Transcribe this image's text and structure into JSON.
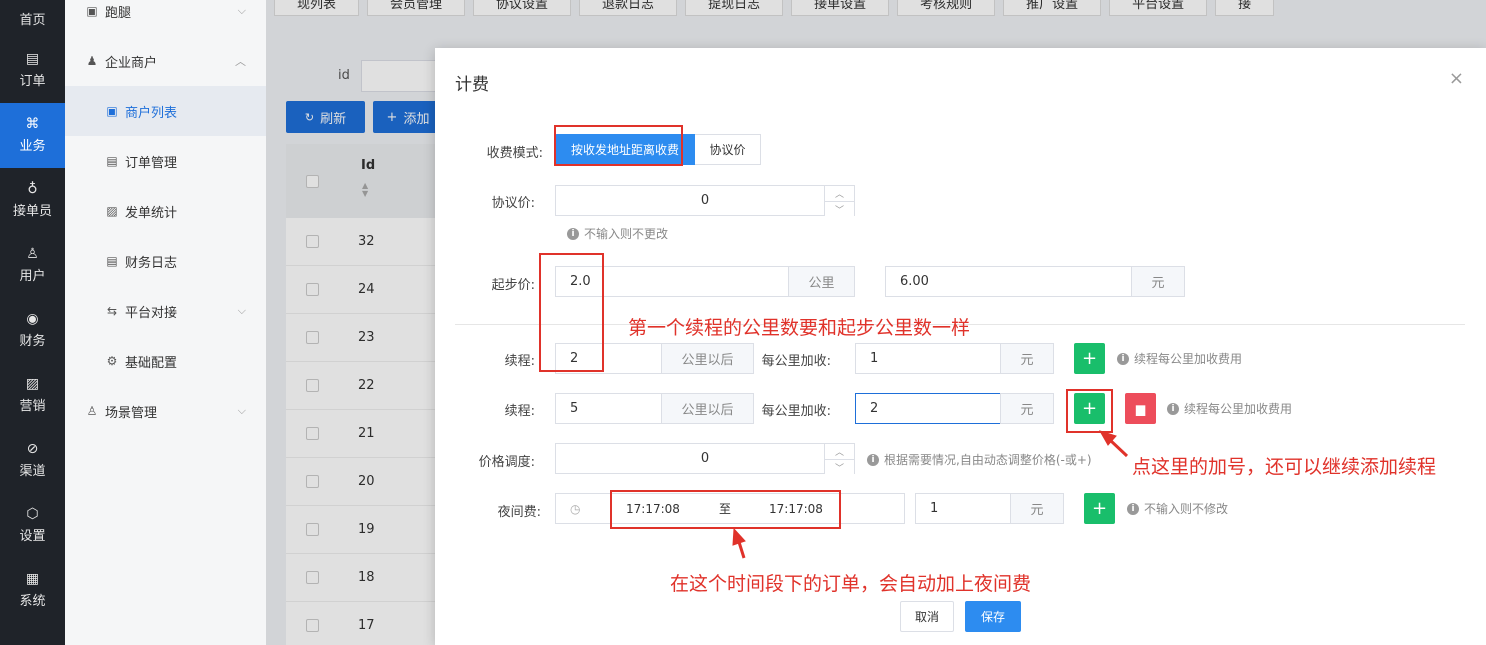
{
  "leftnav": [
    {
      "icon": "home-icon",
      "glyph": "⌂",
      "label": "首页"
    },
    {
      "icon": "order-icon",
      "glyph": "▤",
      "label": "订单"
    },
    {
      "icon": "business-icon",
      "glyph": "⌘",
      "label": "业务"
    },
    {
      "icon": "bike-icon",
      "glyph": "♁",
      "label": "接单员"
    },
    {
      "icon": "user-icon",
      "glyph": "♙",
      "label": "用户"
    },
    {
      "icon": "finance-icon",
      "glyph": "◉",
      "label": "财务"
    },
    {
      "icon": "marketing-icon",
      "glyph": "▨",
      "label": "营销"
    },
    {
      "icon": "channel-icon",
      "glyph": "⊘",
      "label": "渠道"
    },
    {
      "icon": "settings-icon",
      "glyph": "⬡",
      "label": "设置"
    },
    {
      "icon": "system-icon",
      "glyph": "▦",
      "label": "系统"
    }
  ],
  "subnav": {
    "paotui": "跑腿",
    "enterprise": "企业商户",
    "merchant_list": "商户列表",
    "order_manage": "订单管理",
    "dispatch_stats": "发单统计",
    "finance_log": "财务日志",
    "platform": "平台对接",
    "base_config": "基础配置",
    "scene_manage": "场景管理"
  },
  "tabs": [
    "现列表",
    "会员管理",
    "协议设置",
    "退款日志",
    "提现日志",
    "接单设置",
    "考核规则",
    "推广设置",
    "平台设置",
    "接"
  ],
  "filter": {
    "id_label": "id"
  },
  "toolbar": {
    "refresh": "刷新",
    "add": "添加"
  },
  "table": {
    "id_header": "Id",
    "rows": [
      "32",
      "24",
      "23",
      "22",
      "21",
      "20",
      "19",
      "18",
      "17"
    ]
  },
  "modal": {
    "title": "计费",
    "close": "×",
    "mode_label": "收费模式:",
    "mode_option1": "按收发地址距离收费",
    "mode_option2": "协议价",
    "agreement_label": "协议价:",
    "agreement_value": "0",
    "agreement_hint": "不输入则不更改",
    "start_label": "起步价:",
    "start_km": "2.0",
    "start_km_unit": "公里",
    "start_price": "6.00",
    "start_price_unit": "元",
    "cont_label": "续程:",
    "cont1_km": "2",
    "cont_km_unit": "公里以后",
    "per_km_label": "每公里加收:",
    "cont1_price": "1",
    "yuan": "元",
    "cont_hint": "续程每公里加收费用",
    "cont2_km": "5",
    "cont2_price": "2",
    "adjust_label": "价格调度:",
    "adjust_value": "0",
    "adjust_hint": "根据需要情况,自由动态调整价格(-或+)",
    "night_label": "夜间费:",
    "night_start": "17:17:08",
    "night_to": "至",
    "night_end": "17:17:08",
    "night_price": "1",
    "night_hint": "不输入则不修改",
    "cancel": "取消",
    "save": "保存"
  },
  "annotations": {
    "first_cont": "第一个续程的公里数要和起步公里数一样",
    "plus_tip": "点这里的加号，还可以继续添加续程",
    "night_tip": "在这个时间段下的订单，会自动加上夜间费"
  },
  "colors": {
    "primary": "#2d8cf0",
    "nav_dark": "#1f2329",
    "green": "#19be6b",
    "red": "#ed4d5b",
    "annotation": "#e0322a"
  }
}
